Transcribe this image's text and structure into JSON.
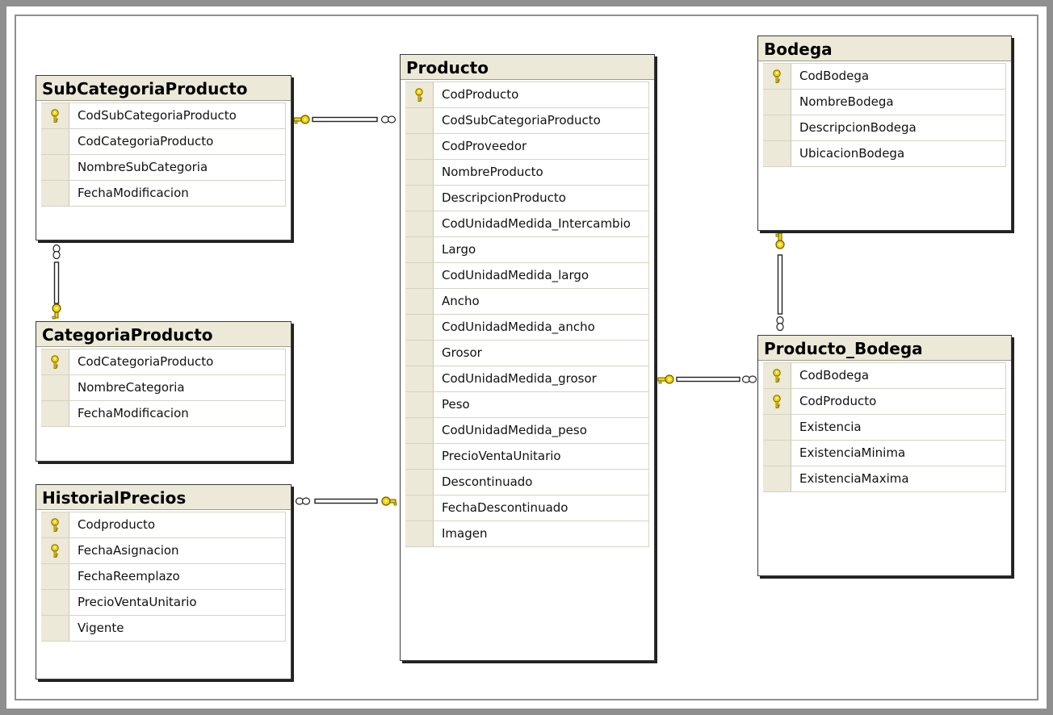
{
  "tables": [
    {
      "name": "SubCategoriaProducto",
      "columns": [
        {
          "name": "CodSubCategoriaProducto",
          "pk": true
        },
        {
          "name": "CodCategoriaProducto",
          "pk": false
        },
        {
          "name": "NombreSubCategoria",
          "pk": false
        },
        {
          "name": "FechaModificacion",
          "pk": false
        }
      ]
    },
    {
      "name": "CategoriaProducto",
      "columns": [
        {
          "name": "CodCategoriaProducto",
          "pk": true
        },
        {
          "name": "NombreCategoria",
          "pk": false
        },
        {
          "name": "FechaModificacion",
          "pk": false
        }
      ]
    },
    {
      "name": "HistorialPrecios",
      "columns": [
        {
          "name": "Codproducto",
          "pk": true
        },
        {
          "name": "FechaAsignacion",
          "pk": true
        },
        {
          "name": "FechaReemplazo",
          "pk": false
        },
        {
          "name": "PrecioVentaUnitario",
          "pk": false
        },
        {
          "name": "Vigente",
          "pk": false
        }
      ]
    },
    {
      "name": "Producto",
      "columns": [
        {
          "name": "CodProducto",
          "pk": true
        },
        {
          "name": "CodSubCategoriaProducto",
          "pk": false
        },
        {
          "name": "CodProveedor",
          "pk": false
        },
        {
          "name": "NombreProducto",
          "pk": false
        },
        {
          "name": "DescripcionProducto",
          "pk": false
        },
        {
          "name": "CodUnidadMedida_Intercambio",
          "pk": false
        },
        {
          "name": "Largo",
          "pk": false
        },
        {
          "name": "CodUnidadMedida_largo",
          "pk": false
        },
        {
          "name": "Ancho",
          "pk": false
        },
        {
          "name": "CodUnidadMedida_ancho",
          "pk": false
        },
        {
          "name": "Grosor",
          "pk": false
        },
        {
          "name": "CodUnidadMedida_grosor",
          "pk": false
        },
        {
          "name": "Peso",
          "pk": false
        },
        {
          "name": "CodUnidadMedida_peso",
          "pk": false
        },
        {
          "name": "PrecioVentaUnitario",
          "pk": false
        },
        {
          "name": "Descontinuado",
          "pk": false
        },
        {
          "name": "FechaDescontinuado",
          "pk": false
        },
        {
          "name": "Imagen",
          "pk": false
        }
      ]
    },
    {
      "name": "Bodega",
      "columns": [
        {
          "name": "CodBodega",
          "pk": true
        },
        {
          "name": "NombreBodega",
          "pk": false
        },
        {
          "name": "DescripcionBodega",
          "pk": false
        },
        {
          "name": "UbicacionBodega",
          "pk": false
        }
      ]
    },
    {
      "name": "Producto_Bodega",
      "columns": [
        {
          "name": "CodBodega",
          "pk": true
        },
        {
          "name": "CodProducto",
          "pk": true
        },
        {
          "name": "Existencia",
          "pk": false
        },
        {
          "name": "ExistenciaMinima",
          "pk": false
        },
        {
          "name": "ExistenciaMaxima",
          "pk": false
        }
      ]
    }
  ],
  "relationships": [
    {
      "one": "SubCategoriaProducto",
      "many": "Producto"
    },
    {
      "one": "CategoriaProducto",
      "many": "SubCategoriaProducto"
    },
    {
      "one": "Producto",
      "many": "HistorialPrecios"
    },
    {
      "one": "Producto",
      "many": "Producto_Bodega"
    },
    {
      "one": "Bodega",
      "many": "Producto_Bodega"
    }
  ],
  "colors": {
    "header": "#ece9d8",
    "key_gold": "#f2d400",
    "connector": "#222222",
    "frame": "#8f8f8f"
  },
  "icons": {
    "primary_key": "key-icon",
    "one_end": "key-icon",
    "many_end": "infinity-icon"
  }
}
